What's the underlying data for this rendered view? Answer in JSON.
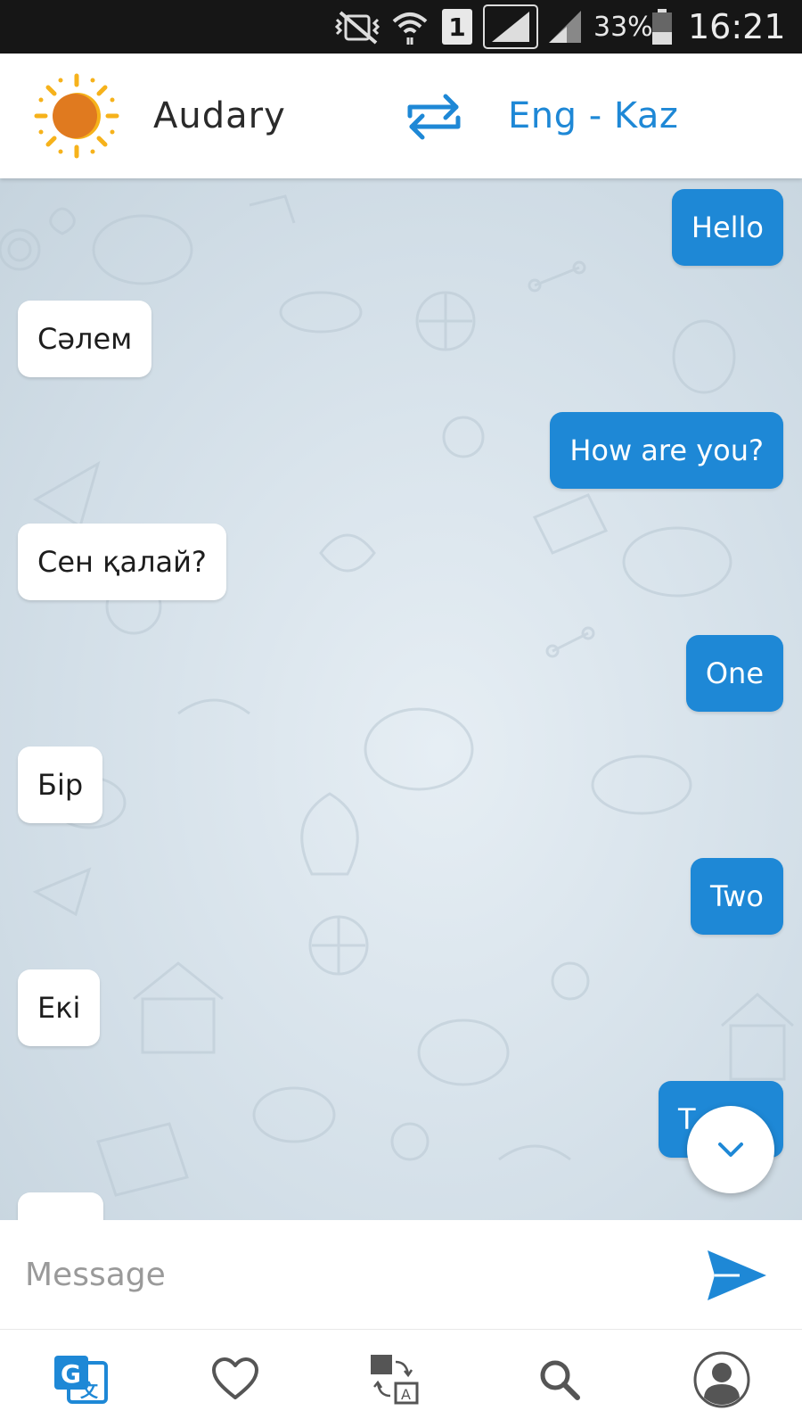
{
  "status_bar": {
    "sim_slot": "1",
    "battery": "33%",
    "time": "16:21"
  },
  "header": {
    "app_title": "Audary",
    "language_pair": "Eng - Kaz"
  },
  "messages": [
    {
      "direction": "out",
      "text": "Hello"
    },
    {
      "direction": "in",
      "text": "Сәлем"
    },
    {
      "direction": "out",
      "text": "How are you?"
    },
    {
      "direction": "in",
      "text": "Сен қалай?"
    },
    {
      "direction": "out",
      "text": "One"
    },
    {
      "direction": "in",
      "text": "Бір"
    },
    {
      "direction": "out",
      "text": "Two"
    },
    {
      "direction": "in",
      "text": "Екі"
    },
    {
      "direction": "out",
      "text": "T"
    }
  ],
  "composer": {
    "placeholder": "Message"
  },
  "bottom_nav": {
    "items": [
      {
        "icon": "translate-icon",
        "active": true
      },
      {
        "icon": "heart-icon",
        "active": false
      },
      {
        "icon": "flashcards-icon",
        "active": false
      },
      {
        "icon": "search-icon",
        "active": false
      },
      {
        "icon": "profile-icon",
        "active": false
      }
    ]
  },
  "colors": {
    "accent": "#1e88d6",
    "status_bar": "#161616",
    "chat_background": "#d3dfe8",
    "sun": "#e07a1f",
    "sun_rays": "#f6b21b"
  }
}
